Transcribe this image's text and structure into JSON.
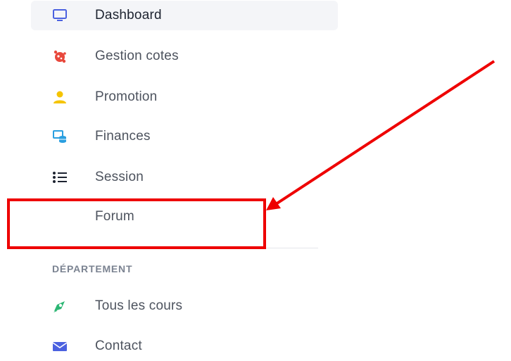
{
  "sidebar": {
    "items": [
      {
        "label": "Dashboard",
        "icon": "monitor-icon",
        "active": true
      },
      {
        "label": "Gestion cotes",
        "icon": "virus-icon"
      },
      {
        "label": "Promotion",
        "icon": "user-icon"
      },
      {
        "label": "Finances",
        "icon": "finance-icon"
      },
      {
        "label": "Session",
        "icon": "list-icon"
      },
      {
        "label": "Forum",
        "icon": ""
      }
    ],
    "section_heading": "DÉPARTEMENT",
    "section_items": [
      {
        "label": "Tous les cours",
        "icon": "rocket-icon"
      },
      {
        "label": "Contact",
        "icon": "mail-icon"
      }
    ]
  },
  "annotation": {
    "box_color": "#ee0000",
    "arrow_color": "#ee0000",
    "target": "Forum"
  },
  "colors": {
    "active_bg": "#f4f5f8",
    "text": "#4d535e",
    "heading": "#7b8391"
  }
}
